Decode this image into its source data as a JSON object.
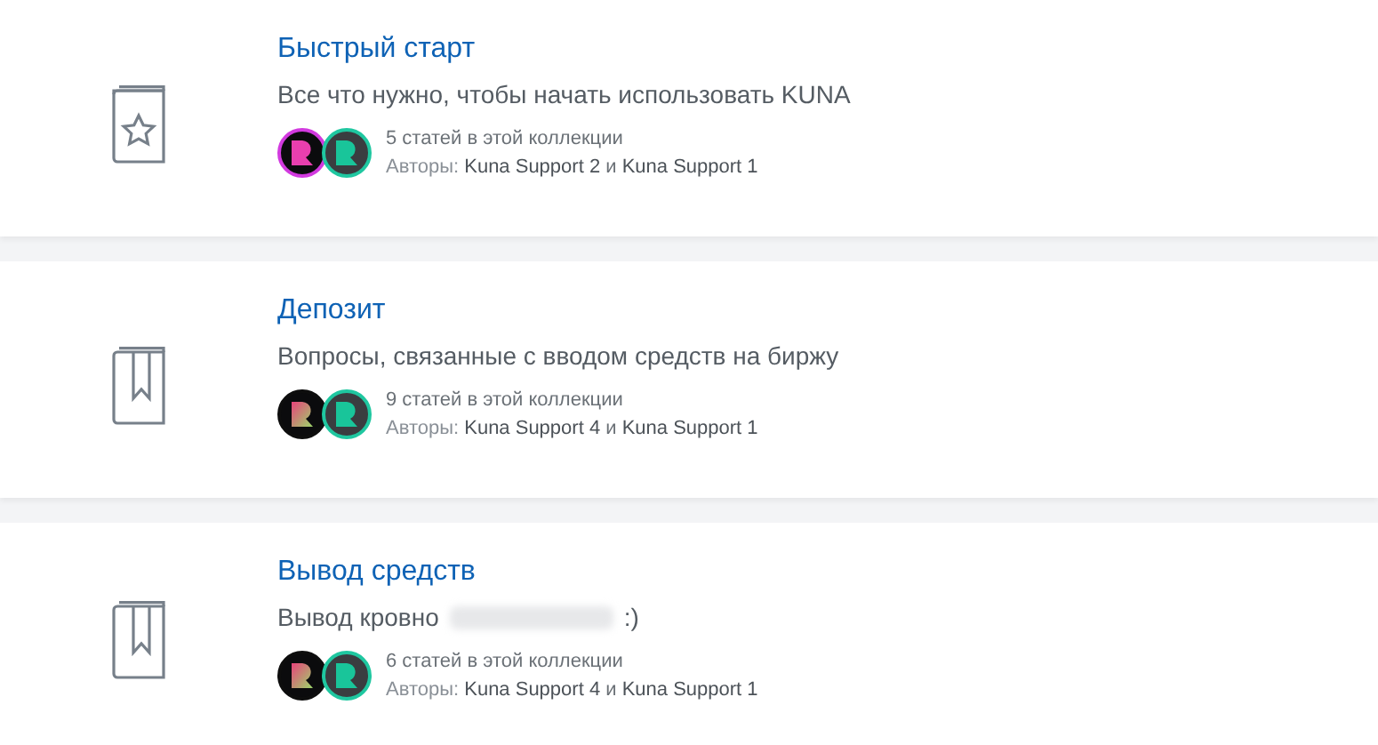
{
  "collections": [
    {
      "kind": "star",
      "title": "Быстрый старт",
      "description": "Все что нужно, чтобы начать использовать KUNA",
      "avatars": [
        {
          "color": "#d23adf"
        },
        {
          "color": "#1fc7a0"
        }
      ],
      "count": "5 статей в этой коллекции",
      "authors_label": "Авторы:",
      "authors": [
        "Kuna Support 2",
        "Kuna Support 1"
      ],
      "joiner": "и"
    },
    {
      "kind": "bookmark",
      "title": "Депозит",
      "description": "Вопросы, связанные с вводом средств на биржу",
      "avatars": [
        {
          "color": "#0d0d0d"
        },
        {
          "color": "#1fc7a0"
        }
      ],
      "count": "9 статей в этой коллекции",
      "authors_label": "Авторы:",
      "authors": [
        "Kuna Support 4",
        "Kuna Support 1"
      ],
      "joiner": "и"
    },
    {
      "kind": "bookmark",
      "title": "Вывод средств",
      "description": "Вывод кровно",
      "redacted_suffix": ":)",
      "avatars": [
        {
          "color": "#0d0d0d"
        },
        {
          "color": "#1fc7a0"
        }
      ],
      "count": "6 статей в этой коллекции",
      "authors_label": "Авторы:",
      "authors": [
        "Kuna Support 4",
        "Kuna Support 1"
      ],
      "joiner": "и"
    }
  ]
}
